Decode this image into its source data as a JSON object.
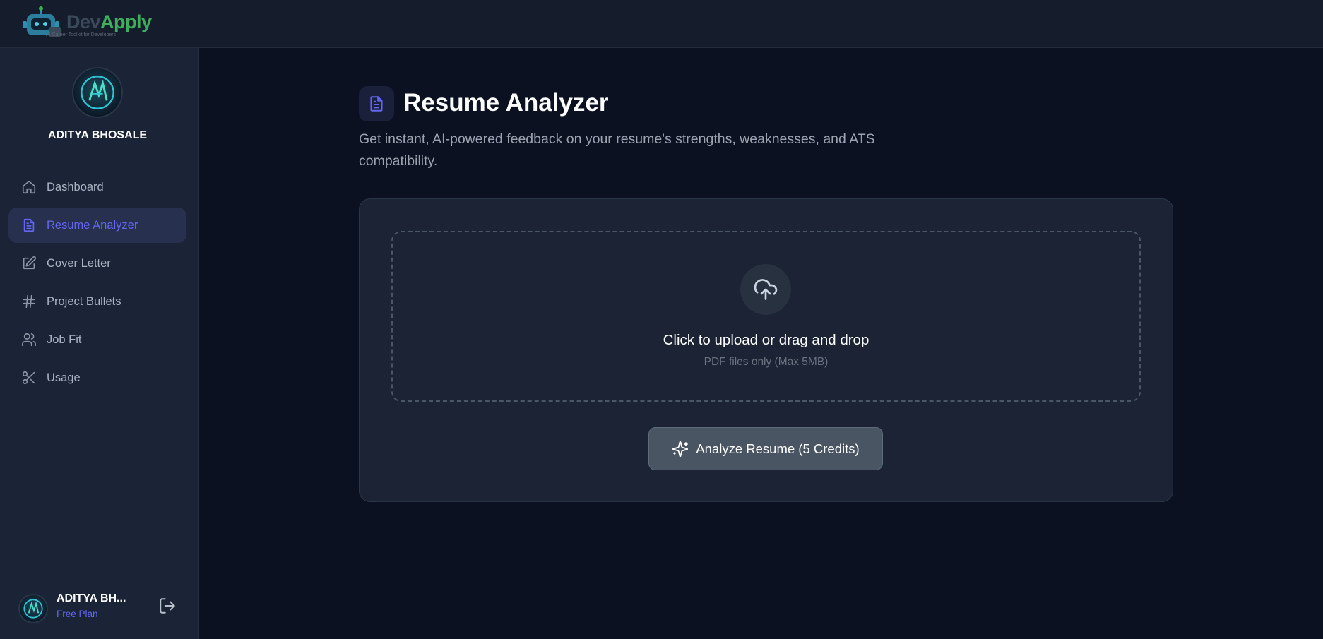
{
  "brand": {
    "name_part1": "Dev",
    "name_part2": "Apply",
    "tagline": "AI Career Toolkit for Developers"
  },
  "colors": {
    "accent": "#6366f1",
    "brand_green": "#3fae5a",
    "background": "#0b1120",
    "sidebar": "#1b2436",
    "card": "#1b2334"
  },
  "sidebar": {
    "profile_name": "ADITYA BHOSALE",
    "items": [
      {
        "label": "Dashboard",
        "icon": "home-icon",
        "active": false
      },
      {
        "label": "Resume Analyzer",
        "icon": "file-text-icon",
        "active": true
      },
      {
        "label": "Cover Letter",
        "icon": "edit-icon",
        "active": false
      },
      {
        "label": "Project Bullets",
        "icon": "hash-icon",
        "active": false
      },
      {
        "label": "Job Fit",
        "icon": "users-icon",
        "active": false
      },
      {
        "label": "Usage",
        "icon": "scissors-icon",
        "active": false
      }
    ],
    "footer": {
      "name": "ADITYA BH...",
      "plan": "Free Plan"
    }
  },
  "main": {
    "title": "Resume Analyzer",
    "subtitle": "Get instant, AI-powered feedback on your resume's strengths, weaknesses, and ATS compatibility.",
    "upload": {
      "title": "Click to upload or drag and drop",
      "hint": "PDF files only (Max 5MB)"
    },
    "analyze_button": "Analyze Resume (5 Credits)"
  }
}
